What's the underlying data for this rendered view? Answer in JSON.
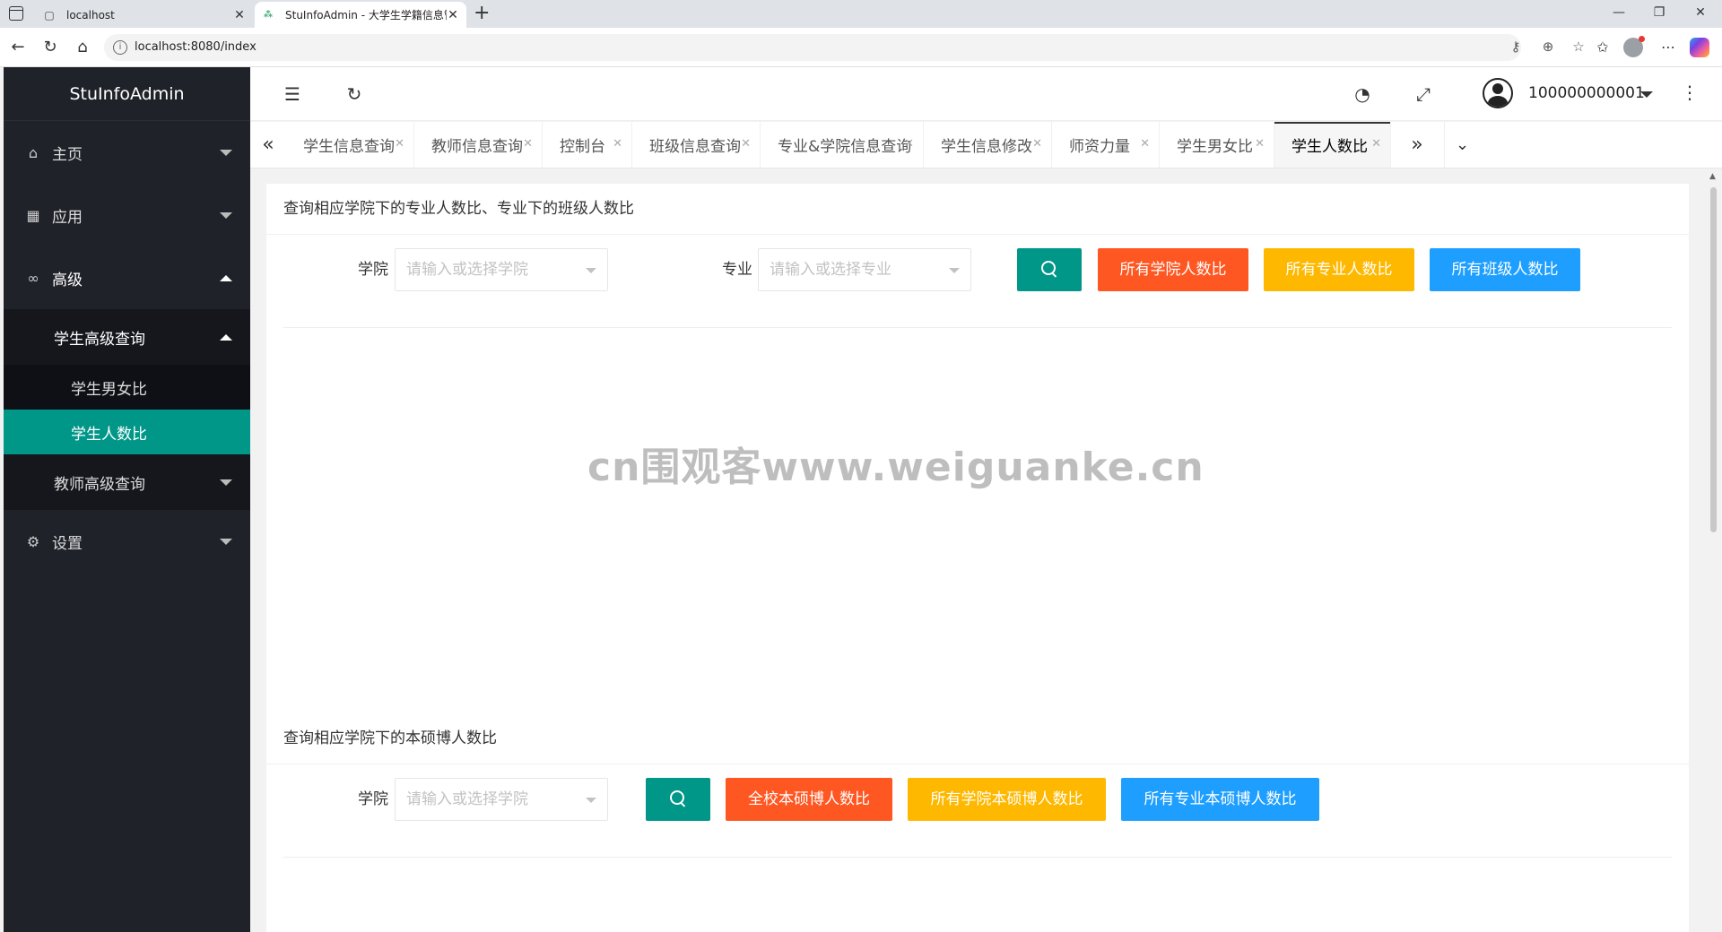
{
  "browser": {
    "tabs": [
      {
        "title": "localhost",
        "active": false
      },
      {
        "title": "StuInfoAdmin - 大学生学籍信息管",
        "active": true
      }
    ],
    "url": "localhost:8080/index"
  },
  "sidebar": {
    "logo": "StuInfoAdmin",
    "menu": [
      {
        "label": "主页",
        "icon": "home-icon"
      },
      {
        "label": "应用",
        "icon": "apps-icon"
      },
      {
        "label": "高级",
        "icon": "infinity-icon"
      },
      {
        "label": "设置",
        "icon": "gear-icon"
      }
    ],
    "advanced": {
      "student_query": "学生高级查询",
      "student_items": [
        "学生男女比",
        "学生人数比"
      ],
      "teacher_query": "教师高级查询"
    }
  },
  "header": {
    "user_name": "100000000001"
  },
  "page_tabs": [
    "学生信息查询",
    "教师信息查询",
    "控制台",
    "班级信息查询",
    "专业&学院信息查询",
    "学生信息修改",
    "师资力量",
    "学生男女比",
    "学生人数比"
  ],
  "content": {
    "section1": {
      "title": "查询相应学院下的专业人数比、专业下的班级人数比",
      "college_label": "学院",
      "college_placeholder": "请输入或选择学院",
      "major_label": "专业",
      "major_placeholder": "请输入或选择专业",
      "buttons": [
        "所有学院人数比",
        "所有专业人数比",
        "所有班级人数比"
      ]
    },
    "section2": {
      "title": "查询相应学院下的本硕博人数比",
      "college_label": "学院",
      "college_placeholder": "请输入或选择学院",
      "buttons": [
        "全校本硕博人数比",
        "所有学院本硕博人数比",
        "所有专业本硕博人数比"
      ]
    },
    "watermark": "cn围观客www.weiguanke.cn"
  },
  "colors": {
    "sidebar_bg": "#20222a",
    "accent_teal": "#009688",
    "btn_red": "#ff5722",
    "btn_orange": "#ffb800",
    "btn_blue": "#1e9fff"
  }
}
